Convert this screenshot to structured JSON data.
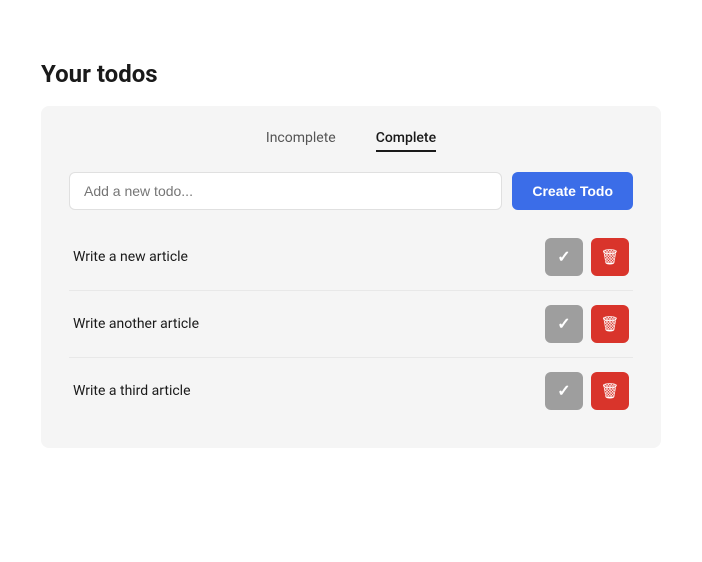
{
  "page": {
    "title": "Your todos"
  },
  "tabs": [
    {
      "id": "incomplete",
      "label": "Incomplete",
      "active": false
    },
    {
      "id": "complete",
      "label": "Complete",
      "active": true
    }
  ],
  "input": {
    "placeholder": "Add a new todo..."
  },
  "create_button": {
    "label": "Create Todo"
  },
  "todos": [
    {
      "id": 1,
      "text": "Write a new article"
    },
    {
      "id": 2,
      "text": "Write another article"
    },
    {
      "id": 3,
      "text": "Write a third article"
    }
  ]
}
